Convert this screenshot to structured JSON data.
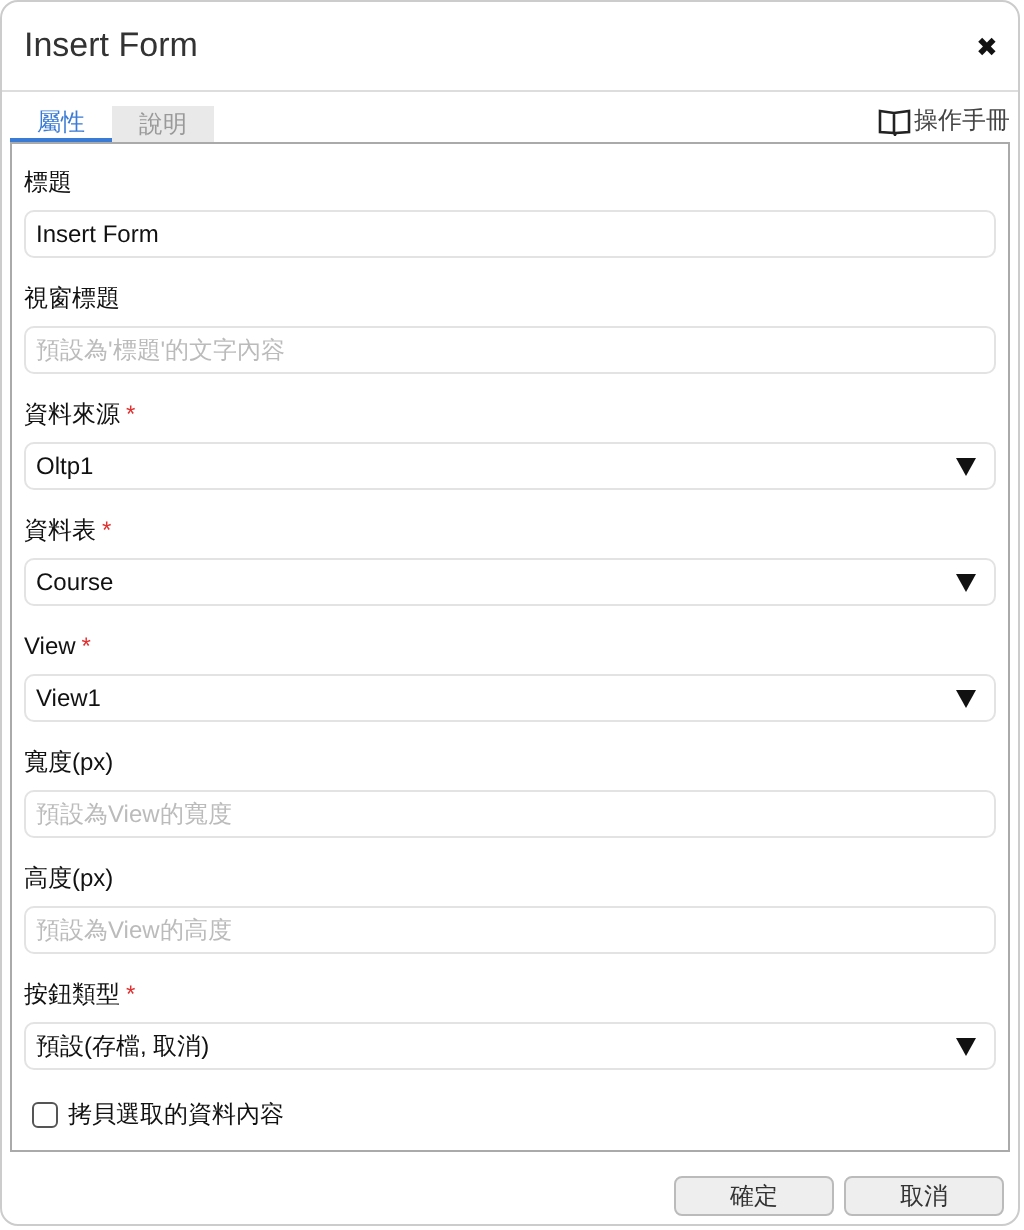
{
  "window": {
    "title": "Insert Form",
    "close": "✖"
  },
  "tabs": [
    {
      "label": "屬性",
      "selected": true
    },
    {
      "label": "說明",
      "selected": false
    }
  ],
  "manual_link": "操作手冊",
  "fields": [
    {
      "kind": "text",
      "label": "標題",
      "value": "Insert Form"
    },
    {
      "kind": "text",
      "label": "視窗標題",
      "placeholder": "預設為'標題'的文字內容"
    },
    {
      "kind": "select",
      "label": "資料來源",
      "required_mark": "*",
      "value": "Oltp1"
    },
    {
      "kind": "select",
      "label": "資料表",
      "required_mark": "*",
      "value": "Course"
    },
    {
      "kind": "select",
      "label": "View",
      "required_mark": "*",
      "value": "View1"
    },
    {
      "kind": "text",
      "label": "寬度(px)",
      "placeholder": "預設為View的寬度"
    },
    {
      "kind": "text",
      "label": "高度(px)",
      "placeholder": "預設為View的高度"
    },
    {
      "kind": "select",
      "label": "按鈕類型",
      "required_mark": "*",
      "value": "預設(存檔, 取消)"
    },
    {
      "kind": "checkbox",
      "label": "拷貝選取的資料內容",
      "checked": false
    }
  ],
  "buttons": [
    "確定",
    "取消"
  ]
}
